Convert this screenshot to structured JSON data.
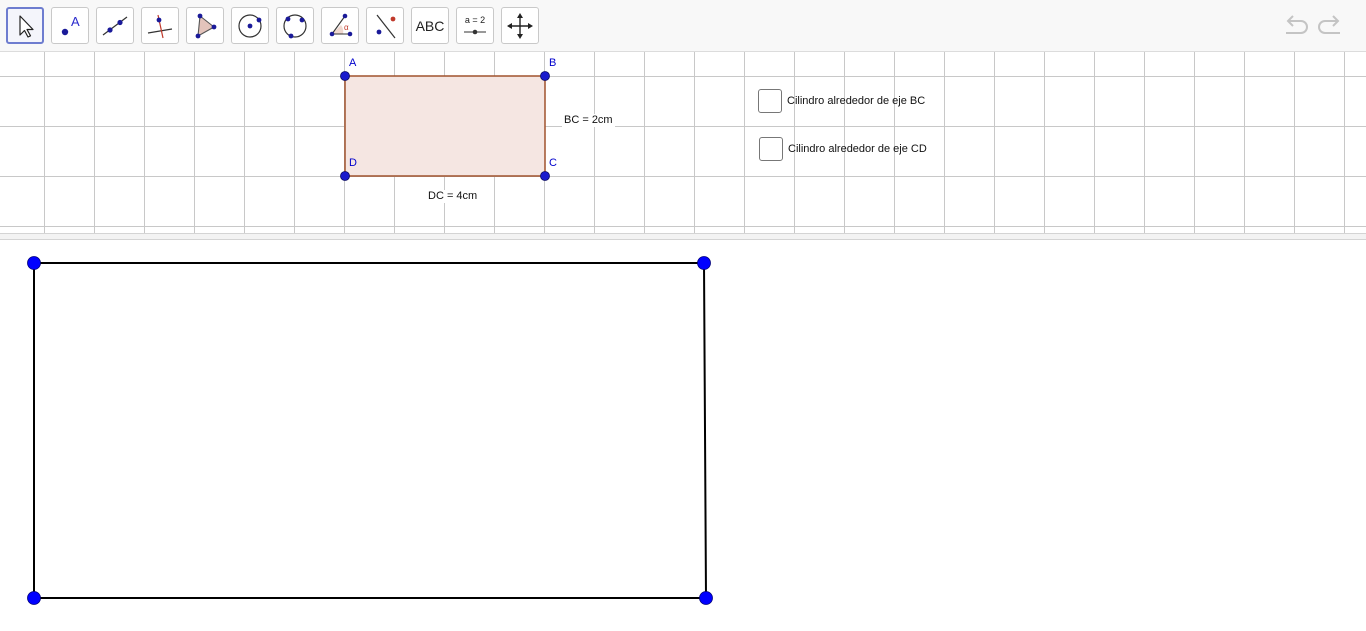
{
  "toolbar": {
    "tools": [
      {
        "name": "move-tool",
        "icon": "arrow-pointer-icon"
      },
      {
        "name": "point-tool",
        "icon": "point-label-icon",
        "glyph": "A"
      },
      {
        "name": "line-tool",
        "icon": "line-through-points-icon"
      },
      {
        "name": "perpendicular-line-tool",
        "icon": "perpendicular-line-icon"
      },
      {
        "name": "polygon-tool",
        "icon": "polygon-icon"
      },
      {
        "name": "circle-center-point-tool",
        "icon": "circle-center-icon"
      },
      {
        "name": "circle-three-points-tool",
        "icon": "circle-three-points-icon"
      },
      {
        "name": "angle-tool",
        "icon": "angle-icon",
        "glyph": "α"
      },
      {
        "name": "reflect-tool",
        "icon": "reflect-about-line-icon"
      },
      {
        "name": "text-tool",
        "icon": "text-icon",
        "label": "ABC"
      },
      {
        "name": "slider-tool",
        "icon": "slider-icon",
        "label": "a = 2"
      },
      {
        "name": "move-graphics-view-tool",
        "icon": "move-cross-arrows-icon"
      }
    ],
    "undo_icon": "undo-icon",
    "redo_icon": "redo-icon"
  },
  "graphics1": {
    "points": [
      {
        "id": "A",
        "label": "A"
      },
      {
        "id": "B",
        "label": "B"
      },
      {
        "id": "C",
        "label": "C"
      },
      {
        "id": "D",
        "label": "D"
      }
    ],
    "measure_bc": "BC = 2cm",
    "measure_dc": "DC = 4cm",
    "checkbox_bc": {
      "label": "Cilindro alrededor de eje BC",
      "checked": false
    },
    "checkbox_cd": {
      "label": "Cilindro alrededor de eje CD",
      "checked": false
    },
    "colors": {
      "point": "#1a1acc",
      "polygon_stroke": "#a0522d",
      "polygon_fill": "#f5e6e2",
      "grid": "#c8c8c8"
    }
  },
  "graphics2": {
    "colors": {
      "point": "#0000ff",
      "stroke": "#000000"
    }
  }
}
